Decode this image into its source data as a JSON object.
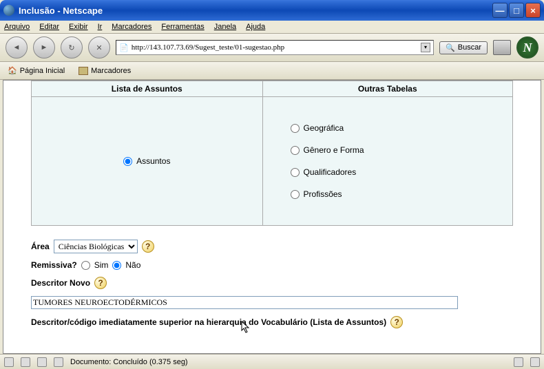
{
  "window": {
    "title": "Inclusão - Netscape",
    "min_glyph": "—",
    "max_glyph": "□",
    "close_glyph": "×"
  },
  "menu": {
    "items": [
      "Arquivo",
      "Editar",
      "Exibir",
      "Ir",
      "Marcadores",
      "Ferramentas",
      "Janela",
      "Ajuda"
    ]
  },
  "toolbar": {
    "back_glyph": "◄",
    "fwd_glyph": "►",
    "reload_glyph": "↻",
    "stop_glyph": "✕",
    "url": "http://143.107.73.69/Sugest_teste/01-sugestao.php",
    "search_label": "Buscar",
    "search_icon_glyph": "🔍",
    "dropdown_glyph": "▾",
    "netscape_letter": "N"
  },
  "bookmarks": {
    "home": "Página Inicial",
    "marcadores": "Marcadores"
  },
  "page": {
    "table_headers": {
      "left": "Lista de Assuntos",
      "right": "Outras Tabelas"
    },
    "left_radio": {
      "label": "Assuntos",
      "checked": true
    },
    "right_radios": [
      {
        "label": "Geográfica",
        "checked": false
      },
      {
        "label": "Gênero e Forma",
        "checked": false
      },
      {
        "label": "Qualificadores",
        "checked": false
      },
      {
        "label": "Profissões",
        "checked": false
      }
    ],
    "area_label": "Área",
    "area_value": "Ciências Biológicas",
    "remissiva_label": "Remissiva?",
    "remissiva_sim": "Sim",
    "remissiva_nao": "Não",
    "remissiva_value": "Não",
    "descritor_novo_label": "Descritor Novo",
    "descritor_novo_value": "TUMORES NEUROECTODÉRMICOS",
    "descritor_superior_label": "Descritor/código imediatamente superior na hierarquia do Vocabulário (Lista de Assuntos)",
    "help_glyph": "?"
  },
  "status": {
    "text": "Documento: Concluído (0.375 seg)"
  }
}
